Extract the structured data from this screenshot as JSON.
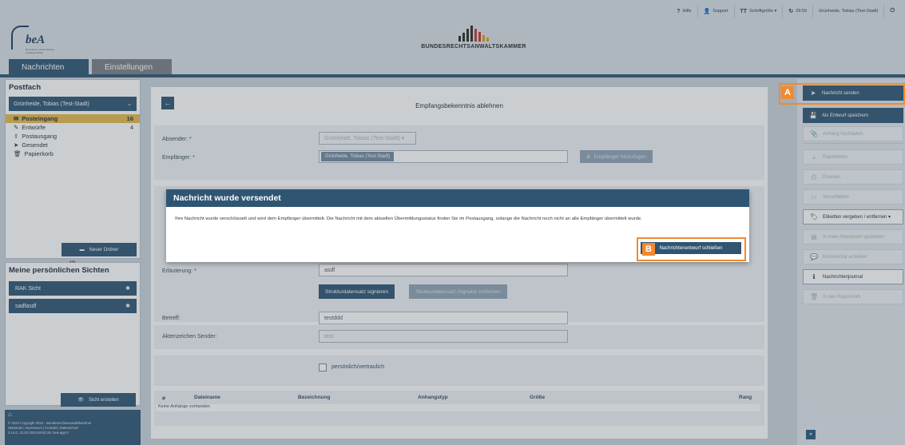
{
  "header": {
    "links": [
      {
        "icon": "help-icon",
        "glyph": "?",
        "label": "Hilfe"
      },
      {
        "icon": "support-icon",
        "glyph": "👤",
        "label": "Support"
      },
      {
        "icon": "fontsize-icon",
        "glyph": "TT",
        "label": "Schriftgröße ▾"
      },
      {
        "icon": "refresh-icon",
        "glyph": "↻",
        "label": "29:59"
      },
      {
        "icon": "user-icon",
        "glyph": "",
        "label": "Grünheide, Tobias (Test-Stadt)"
      },
      {
        "icon": "power-icon",
        "glyph": "⏻",
        "label": ""
      }
    ],
    "logo_text": "beA",
    "logo_sub": "Besonderes elektronisches Anwaltspostfach",
    "brak_text": "BUNDESRECHTSANWALTSKAMMER",
    "tabs": [
      {
        "label": "Nachrichten",
        "active": true
      },
      {
        "label": "Einstellungen",
        "active": false
      }
    ]
  },
  "sidebar": {
    "postfach_title": "Postfach",
    "user_select": "Grünheide, Tobias (Test-Stadt)",
    "folders": [
      {
        "icon": "inbox-icon",
        "glyph": "✉",
        "label": "Posteingang",
        "count": "16",
        "active": true
      },
      {
        "icon": "drafts-icon",
        "glyph": "✎",
        "label": "Entwürfe",
        "count": "4",
        "active": false
      },
      {
        "icon": "outbox-icon",
        "glyph": "⇪",
        "label": "Postausgang",
        "count": "",
        "active": false
      },
      {
        "icon": "sent-icon",
        "glyph": "➤",
        "label": "Gesendet",
        "count": "",
        "active": false
      },
      {
        "icon": "trash-icon",
        "glyph": "🗑",
        "label": "Papierkorb",
        "count": "",
        "active": false
      }
    ],
    "new_folder_label": "Neuer Ordner",
    "views_title": "Meine persönlichen Sichten",
    "views": [
      {
        "label": "RAK Sicht"
      },
      {
        "label": "sadfasdf"
      }
    ],
    "create_view_label": "Sicht erstellen",
    "footer_lines": [
      "© 2023 Copyright 2015 - Bundesrechtsanwaltskammer",
      "Startseite | Impressum | Kontakt | Datenschutz",
      "3.14.0, 22.02.2023 09:53:25, bea-app-0"
    ]
  },
  "form": {
    "title": "Empfangsbekenntnis ablehnen",
    "absender_label": "Absender: *",
    "absender_value": "Grünheide, Tobias (Test-Stadt) ▾",
    "empfaenger_label": "Empfänger: *",
    "empfaenger_chip": "Grünheide, Tobias (Test-Stadt)",
    "add_recipient_label": "Empfänger hinzufügen",
    "erlaeuterung_label": "Erläuterung: *",
    "erlaeuterung_value": "asdf",
    "sign_button": "Strukturdatensatz signieren",
    "remove_sig_button": "Strukturdatensatz-Signatur entfernen",
    "betreff_label": "Betreff:",
    "betreff_value": "testddd",
    "aktenzeichen_label": "Aktenzeichen Sender:",
    "aktenzeichen_value": "test",
    "confidential_label": "persönlich/vertraulich",
    "attachments_headers": [
      "Dateiname",
      "Bezeichnung",
      "Anhangstyp",
      "Größe",
      "Rang"
    ],
    "no_attachments": "Keine Anhänge vorhanden"
  },
  "actions": [
    {
      "icon": "send-icon",
      "glyph": "➤",
      "label": "Nachricht senden",
      "state": "primary"
    },
    {
      "icon": "save-icon",
      "glyph": "💾",
      "label": "Als Entwurf speichern",
      "state": "primary"
    },
    {
      "icon": "attach-icon",
      "glyph": "📎",
      "label": "Anhang hochladen",
      "state": "disabled"
    },
    {
      "icon": "export-icon",
      "glyph": "⤓",
      "label": "Exportieren",
      "state": "disabled"
    },
    {
      "icon": "print-icon",
      "glyph": "⎙",
      "label": "Drucken",
      "state": "disabled"
    },
    {
      "icon": "move-icon",
      "glyph": "▭",
      "label": "Verschieben",
      "state": "disabled"
    },
    {
      "icon": "tag-icon",
      "glyph": "🏷",
      "label": "Etiketten vergeben / entfernen ▾",
      "state": "outline"
    },
    {
      "icon": "file-icon",
      "glyph": "▤",
      "label": "In mein Aktenbuch speichern",
      "state": "disabled"
    },
    {
      "icon": "comment-icon",
      "glyph": "💬",
      "label": "Kommentar erstellen",
      "state": "disabled"
    },
    {
      "icon": "info-icon",
      "glyph": "ℹ",
      "label": "Nachrichtenjournal",
      "state": "outline"
    },
    {
      "icon": "delete-icon",
      "glyph": "🗑",
      "label": "In den Papierkorb",
      "state": "disabled"
    }
  ],
  "expand_glyph": "»",
  "markers": {
    "a": "A",
    "b": "B"
  },
  "modal": {
    "title": "Nachricht wurde versendet",
    "body": "Ihre Nachricht wurde verschlüsselt und wird dem Empfänger übermittelt. Die Nachricht mit dem aktuellen Übermittlungsstatus finden Sie im Postausgang, solange die Nachricht noch nicht an alle Empfänger übermittelt wurde.",
    "close_button": "Nachrichtenentwurf schließen"
  },
  "colors": {
    "primary": "#2f5573",
    "accent": "#f28a2e",
    "active_folder": "#e3b94a"
  }
}
